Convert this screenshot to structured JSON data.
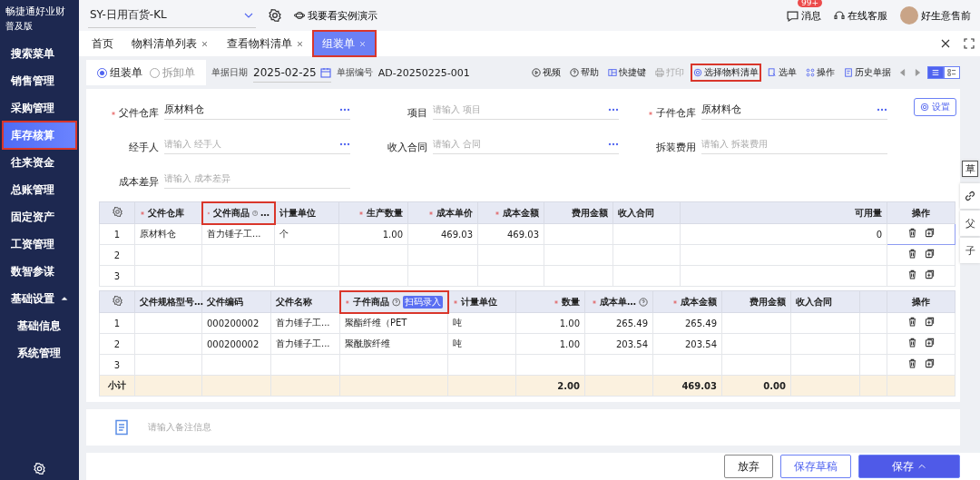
{
  "logo": {
    "brand": "畅捷通好业财",
    "edition": "普及版"
  },
  "sidebar": {
    "items": [
      {
        "label": "搜索菜单",
        "selected": false,
        "highlighted": false
      },
      {
        "label": "销售管理",
        "selected": false,
        "highlighted": false
      },
      {
        "label": "采购管理",
        "selected": false,
        "highlighted": false
      },
      {
        "label": "库存核算",
        "selected": true,
        "highlighted": true
      },
      {
        "label": "往来资金",
        "selected": false,
        "highlighted": false
      },
      {
        "label": "总账管理",
        "selected": false,
        "highlighted": false
      },
      {
        "label": "固定资产",
        "selected": false,
        "highlighted": false
      },
      {
        "label": "工资管理",
        "selected": false,
        "highlighted": false
      },
      {
        "label": "数智参谋",
        "selected": false,
        "highlighted": false
      },
      {
        "label": "基础设置",
        "selected": false,
        "highlighted": false,
        "expanded": true,
        "children": [
          {
            "label": "基础信息",
            "selected": false,
            "highlighted": false
          },
          {
            "label": "系统管理",
            "selected": false,
            "highlighted": false
          }
        ]
      }
    ]
  },
  "header": {
    "company": "SY-日用百货-KL",
    "demo_link": "我要看实例演示",
    "messages": {
      "label": "消息",
      "badge": "99+"
    },
    "support": "在线客服",
    "user": "好生意售前"
  },
  "tabs": [
    {
      "label": "首页",
      "closable": false,
      "selected": false,
      "highlighted": false
    },
    {
      "label": "物料清单列表",
      "closable": true,
      "selected": false,
      "highlighted": false
    },
    {
      "label": "查看物料清单",
      "closable": true,
      "selected": false,
      "highlighted": false
    },
    {
      "label": "组装单",
      "closable": true,
      "selected": true,
      "highlighted": true
    }
  ],
  "doc_types": [
    {
      "label": "组装单",
      "selected": true
    },
    {
      "label": "拆卸单",
      "selected": false
    }
  ],
  "doc_date": {
    "label": "单据日期",
    "value": "2025-02-25"
  },
  "doc_number": {
    "label": "单据编号",
    "value": "AD-20250225-001"
  },
  "actions": [
    {
      "kind": "video",
      "label": "视频",
      "disabled": false,
      "highlighted": false
    },
    {
      "kind": "help",
      "label": "帮助",
      "disabled": false,
      "highlighted": false
    },
    {
      "kind": "keys",
      "label": "快捷键",
      "disabled": false,
      "highlighted": false
    },
    {
      "kind": "print",
      "label": "打印",
      "disabled": true,
      "highlighted": false
    },
    {
      "kind": "bom",
      "label": "选择物料清单",
      "disabled": false,
      "highlighted": true
    },
    {
      "kind": "pick",
      "label": "选单",
      "disabled": false,
      "highlighted": false
    },
    {
      "kind": "ops",
      "label": "操作",
      "disabled": false,
      "highlighted": false
    },
    {
      "kind": "history",
      "label": "历史单据",
      "disabled": false,
      "highlighted": false
    }
  ],
  "view_modes": [
    {
      "kind": "list",
      "selected": true
    },
    {
      "kind": "detail",
      "selected": false
    }
  ],
  "settings_button": "设置",
  "fields": [
    {
      "label": "父件仓库",
      "required": true,
      "value": "原材料仓",
      "more": true
    },
    {
      "label": "项目",
      "required": false,
      "placeholder": "请输入 项目",
      "more": true
    },
    {
      "label": "子件仓库",
      "required": true,
      "value": "原材料仓",
      "more": true
    },
    {
      "label": "经手人",
      "required": false,
      "placeholder": "请输入 经手人",
      "more": true
    },
    {
      "label": "收入合同",
      "required": false,
      "placeholder": "请输入 合同",
      "more": true
    },
    {
      "label": "拆装费用",
      "required": false,
      "placeholder": "请输入 拆装费用",
      "more": false
    },
    {
      "label": "成本差异",
      "required": false,
      "placeholder": "请输入 成本差异",
      "more": false
    }
  ],
  "parent_table": {
    "columns": [
      {
        "label": "父件仓库",
        "required": true,
        "help": false,
        "highlighted": false
      },
      {
        "label": "父件商品",
        "required": true,
        "help": true,
        "suffix": "…",
        "highlighted": true
      },
      {
        "label": "计量单位",
        "required": false,
        "help": false,
        "highlighted": false
      },
      {
        "label": "生产数量",
        "required": true,
        "help": false,
        "highlighted": false
      },
      {
        "label": "成本单价",
        "required": true,
        "help": false,
        "highlighted": false
      },
      {
        "label": "成本金额",
        "required": true,
        "help": false,
        "highlighted": false
      },
      {
        "label": "费用金额",
        "required": false,
        "help": false,
        "highlighted": false
      },
      {
        "label": "收入合同",
        "required": false,
        "help": false,
        "highlighted": false
      },
      {
        "label": "可用量",
        "required": false,
        "help": false,
        "highlighted": false
      }
    ],
    "ops_label": "操作",
    "rows": [
      {
        "no": "1",
        "cells": [
          "原材料仓",
          "首力锤子工...",
          "个",
          "1.00",
          "469.03",
          "469.03",
          null,
          null,
          "0"
        ],
        "focused": true
      },
      {
        "no": "2",
        "cells": [
          null,
          null,
          null,
          null,
          null,
          null,
          null,
          null,
          null
        ],
        "focused": false
      },
      {
        "no": "3",
        "cells": [
          null,
          null,
          null,
          null,
          null,
          null,
          null,
          null,
          null
        ],
        "focused": false
      }
    ]
  },
  "child_table": {
    "columns": [
      {
        "label": "父件规格型号",
        "required": false,
        "help": false,
        "suffix": "…",
        "highlighted": false
      },
      {
        "label": "父件编码",
        "required": false,
        "help": false,
        "highlighted": false
      },
      {
        "label": "父件名称",
        "required": false,
        "help": false,
        "highlighted": false
      },
      {
        "label": "子件商品",
        "required": true,
        "help": true,
        "tag": "扫码录入",
        "highlighted": true
      },
      {
        "label": "计量单位",
        "required": true,
        "help": false,
        "highlighted": false
      },
      {
        "label": "数量",
        "required": true,
        "help": false,
        "highlighted": false
      },
      {
        "label": "成本单…",
        "required": true,
        "help": true,
        "highlighted": false
      },
      {
        "label": "成本金额",
        "required": true,
        "help": false,
        "highlighted": false
      },
      {
        "label": "费用金额",
        "required": false,
        "help": false,
        "highlighted": false
      },
      {
        "label": "收入合同",
        "required": false,
        "help": false,
        "highlighted": false
      },
      {
        "highlighted": false
      }
    ],
    "ops_label": "操作",
    "rows": [
      {
        "no": "1",
        "cells": [
          null,
          "000200002",
          "首力锤子工...",
          "聚酯纤维（PET",
          "吨",
          "1.00",
          "265.49",
          "265.49",
          null,
          null,
          null
        ],
        "focused": false
      },
      {
        "no": "2",
        "cells": [
          null,
          "000200002",
          "首力锤子工...",
          "聚酰胺纤维",
          "吨",
          "1.00",
          "203.54",
          "203.54",
          null,
          null,
          null
        ],
        "focused": false
      },
      {
        "no": "3",
        "cells": [
          null,
          null,
          null,
          null,
          null,
          null,
          null,
          null,
          null,
          null,
          null
        ],
        "focused": false
      }
    ],
    "subtotal": {
      "label": "小计",
      "cells": [
        null,
        null,
        null,
        null,
        null,
        "2.00",
        null,
        "469.03",
        "0.00",
        null,
        null
      ]
    }
  },
  "memo": {
    "placeholder": "请输入备注信息"
  },
  "side_tools": [
    {
      "kind": "draft",
      "label": "草"
    },
    {
      "kind": "link"
    },
    {
      "kind": "parent",
      "label": "父"
    },
    {
      "kind": "child",
      "label": "子"
    }
  ],
  "footer_buttons": [
    {
      "kind": "plain",
      "label": "放弃"
    },
    {
      "kind": "outline",
      "label": "保存草稿"
    },
    {
      "kind": "primary",
      "label": "保存"
    }
  ]
}
